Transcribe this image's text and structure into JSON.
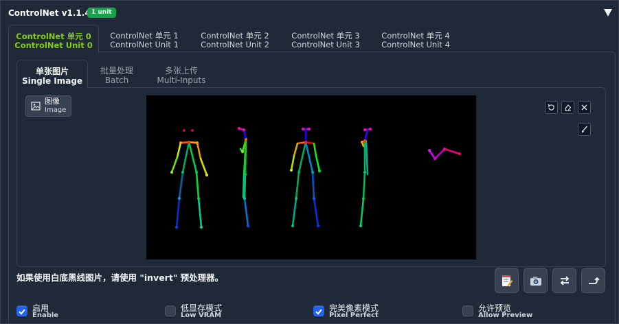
{
  "header": {
    "title": "ControlNet v1.1.449",
    "badge": "1 unit"
  },
  "unit_tabs": [
    {
      "zh": "ControlNet 单元 0",
      "en": "ControlNet Unit 0",
      "active": true
    },
    {
      "zh": "ControlNet 单元 1",
      "en": "ControlNet Unit 1",
      "active": false
    },
    {
      "zh": "ControlNet 单元 2",
      "en": "ControlNet Unit 2",
      "active": false
    },
    {
      "zh": "ControlNet 单元 3",
      "en": "ControlNet Unit 3",
      "active": false
    },
    {
      "zh": "ControlNet 单元 4",
      "en": "ControlNet Unit 4",
      "active": false
    }
  ],
  "mode_tabs": [
    {
      "zh": "单张图片",
      "en": "Single Image",
      "active": true
    },
    {
      "zh": "批量处理",
      "en": "Batch",
      "active": false
    },
    {
      "zh": "多张上传",
      "en": "Multi-Inputs",
      "active": false
    }
  ],
  "image_label": {
    "zh": "图像",
    "en": "Image"
  },
  "tools": {
    "undo": "undo-icon",
    "erase": "eraser-icon",
    "close": "close-icon",
    "brush": "brush-icon"
  },
  "hint": "如果使用白底黑线图片，请使用 \"invert\" 预处理器。",
  "actions": [
    {
      "name": "edit-annotation-button",
      "icon": "notepad-icon"
    },
    {
      "name": "webcam-button",
      "icon": "camera-icon"
    },
    {
      "name": "swap-button",
      "icon": "swap-arrows-icon"
    },
    {
      "name": "send-dimensions-button",
      "icon": "return-arrow-icon"
    }
  ],
  "options": [
    {
      "zh": "启用",
      "en": "Enable",
      "checked": true
    },
    {
      "zh": "低显存模式",
      "en": "Low VRAM",
      "checked": false
    },
    {
      "zh": "完美像素模式",
      "en": "Pixel Perfect",
      "checked": true
    },
    {
      "zh": "允许预览",
      "en": "Allow Preview",
      "checked": false
    }
  ],
  "colors": {
    "accent": "#84cc16",
    "badge": "#16a34a",
    "checkbox": "#2563eb"
  }
}
